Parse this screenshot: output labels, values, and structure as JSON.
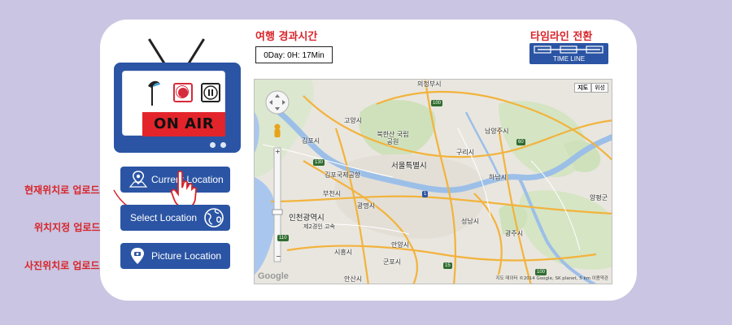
{
  "elapsed": {
    "title": "여행 경과시간",
    "value": "0Day: 0H: 17Min"
  },
  "timeline": {
    "title": "타임라인 전환",
    "button_label": "TIME LINE"
  },
  "tv": {
    "onair_label": "ON AIR"
  },
  "upload": {
    "current": {
      "side_label": "현재위치로 업로드",
      "button_label": "Current Location"
    },
    "select": {
      "side_label": "위치지정 업로드",
      "button_label": "Select Location"
    },
    "picture": {
      "side_label": "사진위치로 업로드",
      "button_label": "Picture Location"
    }
  },
  "map": {
    "type_options": [
      "지도",
      "위성"
    ],
    "selected_type": "지도",
    "zoom_in": "+",
    "zoom_out": "−",
    "labels": {
      "uijeongbu": "의정부시",
      "goyang": "고양시",
      "bukhansan": "북한산 국립공원",
      "namyangju": "남양주시",
      "gimpo": "김포시",
      "guri": "구리시",
      "gimpo_airport": "김포국제공항",
      "seoul": "서울특별시",
      "bucheon": "부천시",
      "hanam": "하남시",
      "gwangmyeong": "광명시",
      "yangpyeong": "양평군",
      "incheon": "인천광역시",
      "incheon_airport2": "제2경인 고속",
      "seongnam": "성남시",
      "gwangju": "광주시",
      "anyang": "안양시",
      "siheung": "시흥시",
      "gunpo": "군포시",
      "ansan": "안산시"
    },
    "shields": {
      "s100a": "100",
      "s100b": "100",
      "s1": "1",
      "s60": "60",
      "s110": "110",
      "s130": "130",
      "s15": "15",
      "s100c": "100"
    },
    "logo": "Google",
    "credit": "지도 데이터 ©2014 Google, SK planet,   5 km        이용약관"
  },
  "colors": {
    "accent": "#2b55a4",
    "label_red": "#d8242a",
    "background": "#c9c5e2"
  }
}
